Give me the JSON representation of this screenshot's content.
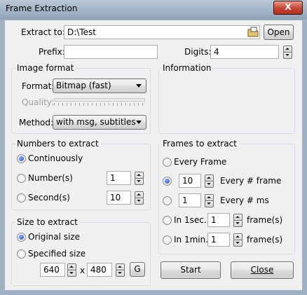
{
  "window": {
    "title": "Frame Extraction",
    "close_glyph": "X"
  },
  "extract_to": {
    "label": "Extract to:",
    "value": "D:\\Test",
    "open_button": "Open"
  },
  "prefix": {
    "label": "Prefix:",
    "value": ""
  },
  "digits": {
    "label": "Digits:",
    "value": "4"
  },
  "image_format": {
    "title": "Image format",
    "format_label": "Format:",
    "format_value": "Bitmap (fast)",
    "quality_label": "Quality:",
    "method_label": "Method:",
    "method_value": "with msg, subtitles"
  },
  "information": {
    "title": "Information"
  },
  "numbers_to_extract": {
    "title": "Numbers to extract",
    "continuously": "Continuously",
    "numbers": "Number(s)",
    "numbers_value": "1",
    "seconds": "Second(s)",
    "seconds_value": "10",
    "selected": "continuously"
  },
  "frames_to_extract": {
    "title": "Frames to extract",
    "every_frame": "Every Frame",
    "every_n_value": "10",
    "every_n_label": "Every # frame",
    "every_ms_value": "1",
    "every_ms_label": "Every # ms",
    "in_1sec_label": "In 1sec.",
    "in_1sec_value": "1",
    "in_1sec_unit": "frame(s)",
    "in_1min_label": "In 1min.",
    "in_1min_value": "1",
    "in_1min_unit": "frame(s)",
    "selected": "every_n_frame"
  },
  "size_to_extract": {
    "title": "Size to extract",
    "original": "Original size",
    "specified": "Specified size",
    "width": "640",
    "x_sep": "x",
    "height": "480",
    "g_button": "G",
    "selected": "original"
  },
  "buttons": {
    "start": "Start",
    "close": "Close"
  }
}
